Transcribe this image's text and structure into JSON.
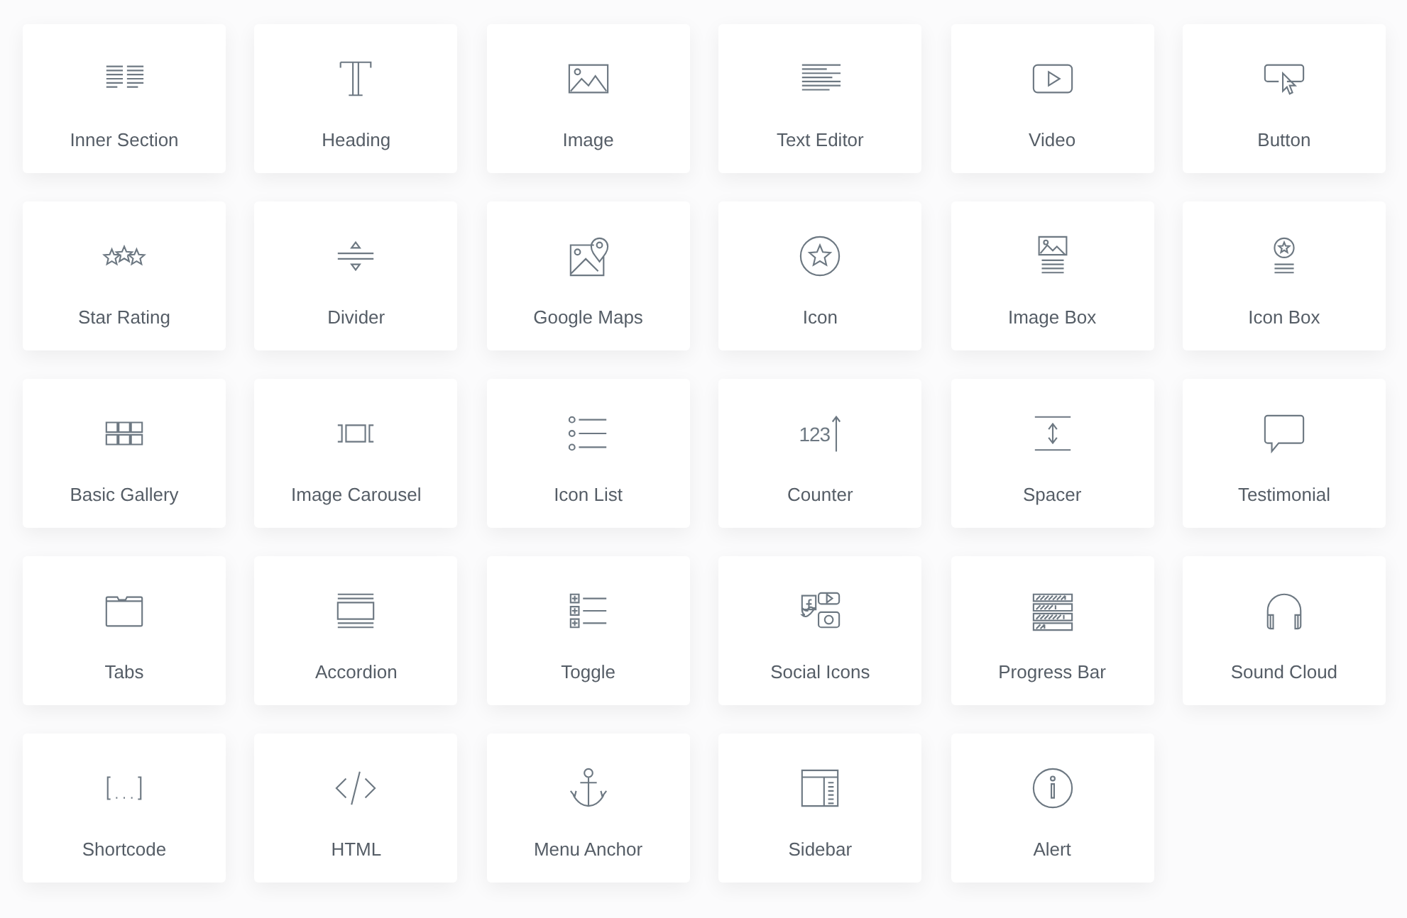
{
  "widgets": [
    {
      "label": "Inner Section",
      "kind": "inner-section"
    },
    {
      "label": "Heading",
      "kind": "heading"
    },
    {
      "label": "Image",
      "kind": "image"
    },
    {
      "label": "Text Editor",
      "kind": "text-editor"
    },
    {
      "label": "Video",
      "kind": "video"
    },
    {
      "label": "Button",
      "kind": "button"
    },
    {
      "label": "Star Rating",
      "kind": "star-rating"
    },
    {
      "label": "Divider",
      "kind": "divider"
    },
    {
      "label": "Google Maps",
      "kind": "google-maps"
    },
    {
      "label": "Icon",
      "kind": "icon"
    },
    {
      "label": "Image Box",
      "kind": "image-box"
    },
    {
      "label": "Icon Box",
      "kind": "icon-box"
    },
    {
      "label": "Basic Gallery",
      "kind": "basic-gallery"
    },
    {
      "label": "Image Carousel",
      "kind": "image-carousel"
    },
    {
      "label": "Icon List",
      "kind": "icon-list"
    },
    {
      "label": "Counter",
      "kind": "counter",
      "glyph": "123"
    },
    {
      "label": "Spacer",
      "kind": "spacer"
    },
    {
      "label": "Testimonial",
      "kind": "testimonial"
    },
    {
      "label": "Tabs",
      "kind": "tabs"
    },
    {
      "label": "Accordion",
      "kind": "accordion"
    },
    {
      "label": "Toggle",
      "kind": "toggle"
    },
    {
      "label": "Social Icons",
      "kind": "social-icons"
    },
    {
      "label": "Progress Bar",
      "kind": "progress-bar"
    },
    {
      "label": "Sound Cloud",
      "kind": "sound-cloud"
    },
    {
      "label": "Shortcode",
      "kind": "shortcode"
    },
    {
      "label": "HTML",
      "kind": "html"
    },
    {
      "label": "Menu Anchor",
      "kind": "menu-anchor"
    },
    {
      "label": "Sidebar",
      "kind": "sidebar"
    },
    {
      "label": "Alert",
      "kind": "alert"
    }
  ]
}
